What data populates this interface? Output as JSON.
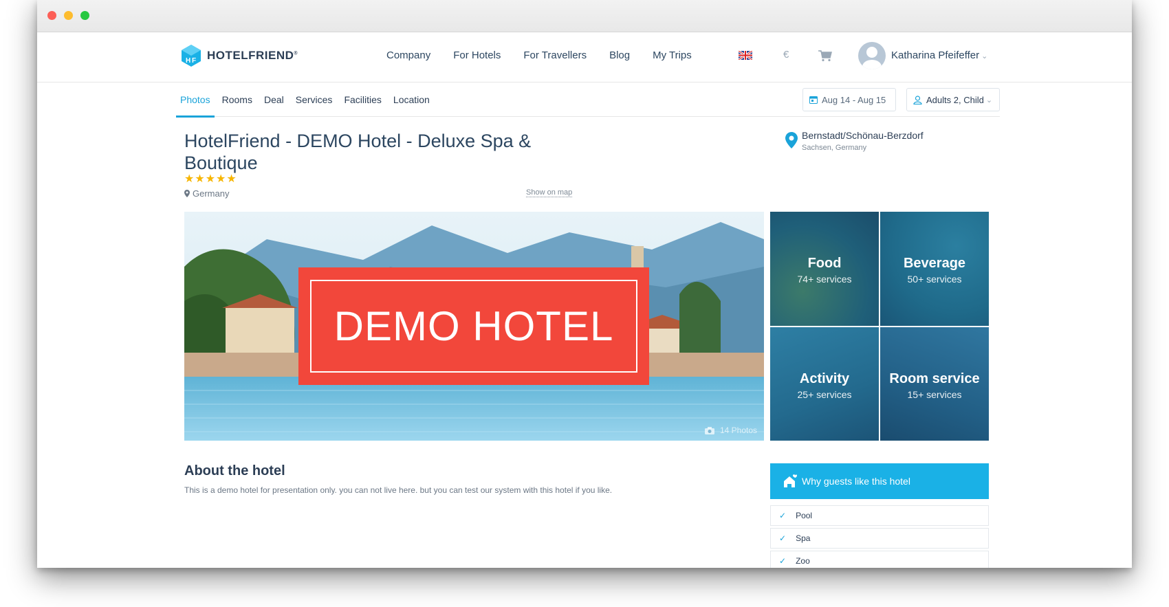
{
  "brand": {
    "name": "HOTELFRIEND",
    "mark": "®"
  },
  "nav": {
    "items": [
      "Company",
      "For Hotels",
      "For Travellers",
      "Blog",
      "My Trips"
    ],
    "currency": "€",
    "user_name": "Katharina Pfeifeffer"
  },
  "subnav": {
    "tabs": [
      "Photos",
      "Rooms",
      "Deal",
      "Services",
      "Facilities",
      "Location"
    ],
    "active_tab": "Photos",
    "dates": "Aug 14 - Aug 15",
    "guests": "Adults 2, Child"
  },
  "hotel": {
    "title": "HotelFriend - DEMO Hotel - Deluxe Spa & Boutique",
    "stars": "★★★★★",
    "country": "Germany",
    "show_on_map": "Show on map",
    "city": "Bernstadt/Schönau-Berzdorf",
    "region": "Sachsen, Germany",
    "banner_text": "DEMO HOTEL",
    "photo_count": "14 Photos"
  },
  "services": [
    {
      "name": "Food",
      "count": "74+ services"
    },
    {
      "name": "Beverage",
      "count": "50+ services"
    },
    {
      "name": "Activity",
      "count": "25+ services"
    },
    {
      "name": "Room service",
      "count": "15+ services"
    }
  ],
  "about": {
    "title": "About the hotel",
    "text": "This is a demo hotel for presentation only. you can not live here. but you can test our system with this hotel if you like."
  },
  "why": {
    "title": "Why guests like this hotel",
    "items": [
      "Pool",
      "Spa",
      "Zoo"
    ]
  },
  "colors": {
    "accent": "#1ab1e6",
    "banner": "#f2473b",
    "star": "#f7b500"
  }
}
